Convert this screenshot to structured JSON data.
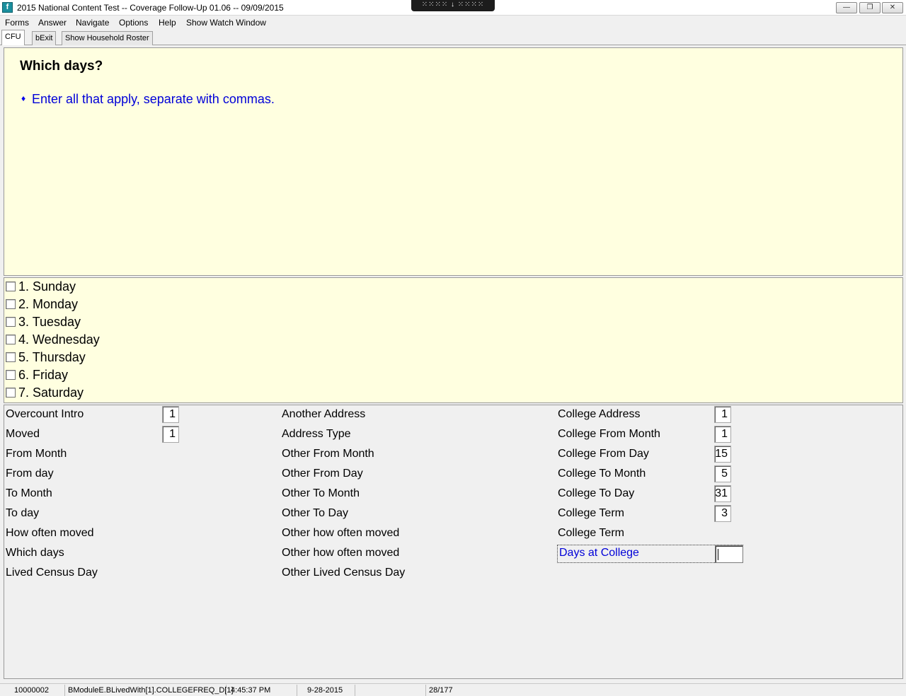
{
  "window": {
    "title": "2015 National Content Test -- Coverage Follow-Up 01.06 -- 09/09/2015",
    "center_control": "⁙⁙⁙⁙ ↓ ⁙⁙⁙⁙",
    "buttons": {
      "minimize": "―",
      "maximize": "❐",
      "close": "✕"
    }
  },
  "menu": [
    "Forms",
    "Answer",
    "Navigate",
    "Options",
    "Help",
    "Show Watch Window"
  ],
  "tabs": [
    "CFU",
    "bExit",
    "Show Household Roster"
  ],
  "question": {
    "text": "Which days?",
    "instruction_bullet": "♦",
    "instruction": "Enter all that apply, separate with commas."
  },
  "options": [
    "1. Sunday",
    "2. Monday",
    "3. Tuesday",
    "4. Wednesday",
    "5. Thursday",
    "6. Friday",
    "7. Saturday"
  ],
  "fields": {
    "col1": [
      {
        "label": "Overcount Intro",
        "value": "1"
      },
      {
        "label": "Moved",
        "value": "1"
      },
      {
        "label": "From Month",
        "value": ""
      },
      {
        "label": "From day",
        "value": ""
      },
      {
        "label": "To Month",
        "value": ""
      },
      {
        "label": "To day",
        "value": ""
      },
      {
        "label": "How often moved",
        "value": ""
      },
      {
        "label": "Which days",
        "value": ""
      },
      {
        "label": "Lived Census Day",
        "value": ""
      }
    ],
    "col2": [
      {
        "label": "Another Address"
      },
      {
        "label": "Address Type"
      },
      {
        "label": "Other From Month"
      },
      {
        "label": "Other From Day"
      },
      {
        "label": "Other To Month"
      },
      {
        "label": "Other To Day"
      },
      {
        "label": "Other how often moved"
      },
      {
        "label": "Other how often moved"
      },
      {
        "label": "Other Lived Census Day"
      }
    ],
    "col3": [
      {
        "label": "College Address",
        "value": "1"
      },
      {
        "label": "College From Month",
        "value": "1"
      },
      {
        "label": "College From Day",
        "value": "15"
      },
      {
        "label": "College To Month",
        "value": "5"
      },
      {
        "label": "College To Day",
        "value": "31"
      },
      {
        "label": "College Term",
        "value": "3"
      },
      {
        "label": "College Term",
        "value": ""
      }
    ],
    "active": {
      "label": "Days at College",
      "value": ""
    }
  },
  "status": {
    "case_id": "10000002",
    "field_path": "BModuleE.BLivedWith[1].COLLEGEFREQ_D[1]",
    "time": "4:45:37 PM",
    "date": "9-28-2015",
    "blank": "",
    "page": "28/177"
  }
}
